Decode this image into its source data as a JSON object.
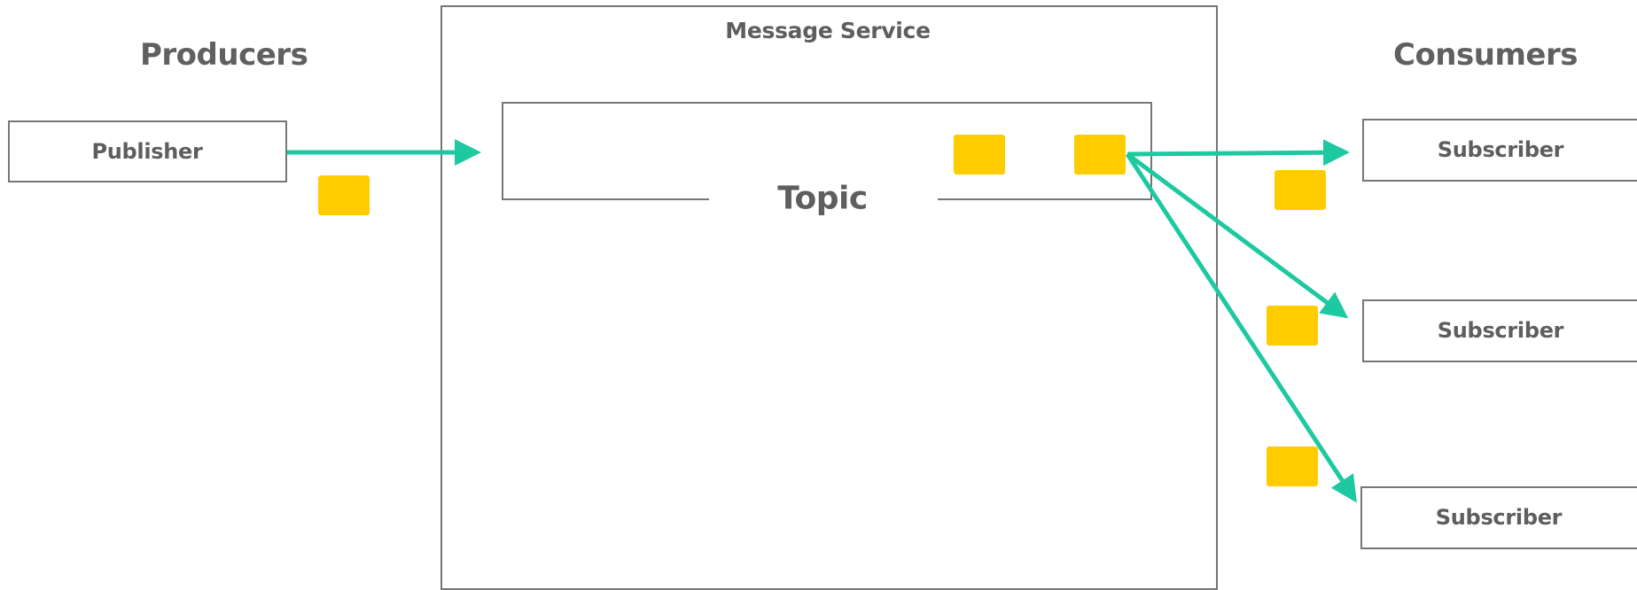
{
  "diagram": {
    "producers_heading": "Producers",
    "consumers_heading": "Consumers",
    "service_title": "Message Service",
    "topic_label": "Topic",
    "publisher_label": "Publisher",
    "subscribers": [
      {
        "label": "Subscriber"
      },
      {
        "label": "Subscriber"
      },
      {
        "label": "Subscriber"
      }
    ],
    "colors": {
      "arrow": "#1ec8a0",
      "message": "#ffcc00",
      "border": "#767676",
      "text": "#5e5e5e"
    }
  }
}
